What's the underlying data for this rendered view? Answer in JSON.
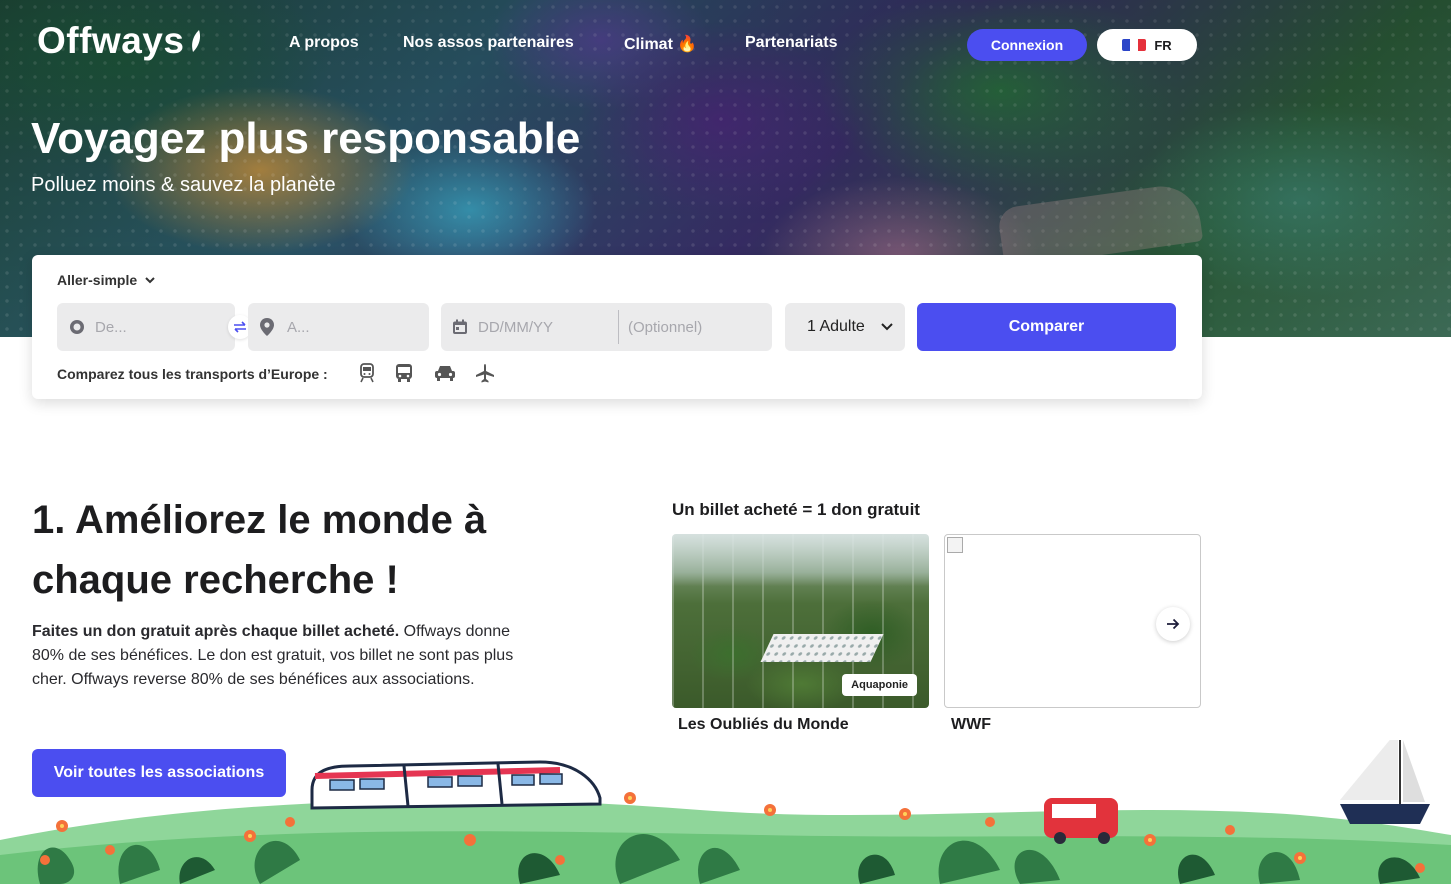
{
  "brand": {
    "logo_text": "Offways"
  },
  "nav": {
    "items": [
      {
        "label": "A propos"
      },
      {
        "label": "Nos assos partenaires"
      },
      {
        "label": "Climat 🔥"
      },
      {
        "label": "Partenariats"
      }
    ],
    "login_label": "Connexion",
    "lang_label": "FR"
  },
  "hero": {
    "title": "Voyagez plus responsable",
    "subtitle": "Polluez moins & sauvez la planète"
  },
  "search": {
    "trip_type": "Aller-simple",
    "from_placeholder": "De...",
    "to_placeholder": "A...",
    "date_placeholder": "DD/MM/YY",
    "return_placeholder": "(Optionnel)",
    "passengers": "1 Adulte",
    "submit_label": "Comparer",
    "transports_label": "Comparez tous les transports d’Europe :",
    "transport_icons": [
      "train-icon",
      "bus-icon",
      "car-icon",
      "plane-icon"
    ]
  },
  "section1": {
    "title": "1. Améliorez le monde à chaque recherche !",
    "text_bold": "Faites un don gratuit après chaque billet acheté.",
    "text_rest": " Offways donne 80% de ses bénéfices. Le don est gratuit, vos billet ne sont pas plus cher. Offways reverse 80% de ses bénéfices aux associations.",
    "cta_label": "Voir toutes les associations"
  },
  "donations": {
    "title": "Un billet acheté = 1 don gratuit",
    "cards": [
      {
        "name": "Les Oubliés du Monde",
        "badge": "Aquaponie"
      },
      {
        "name": "WWF",
        "badge": ""
      }
    ]
  },
  "colors": {
    "accent": "#4b4ef0",
    "field_bg": "#ebebec"
  }
}
